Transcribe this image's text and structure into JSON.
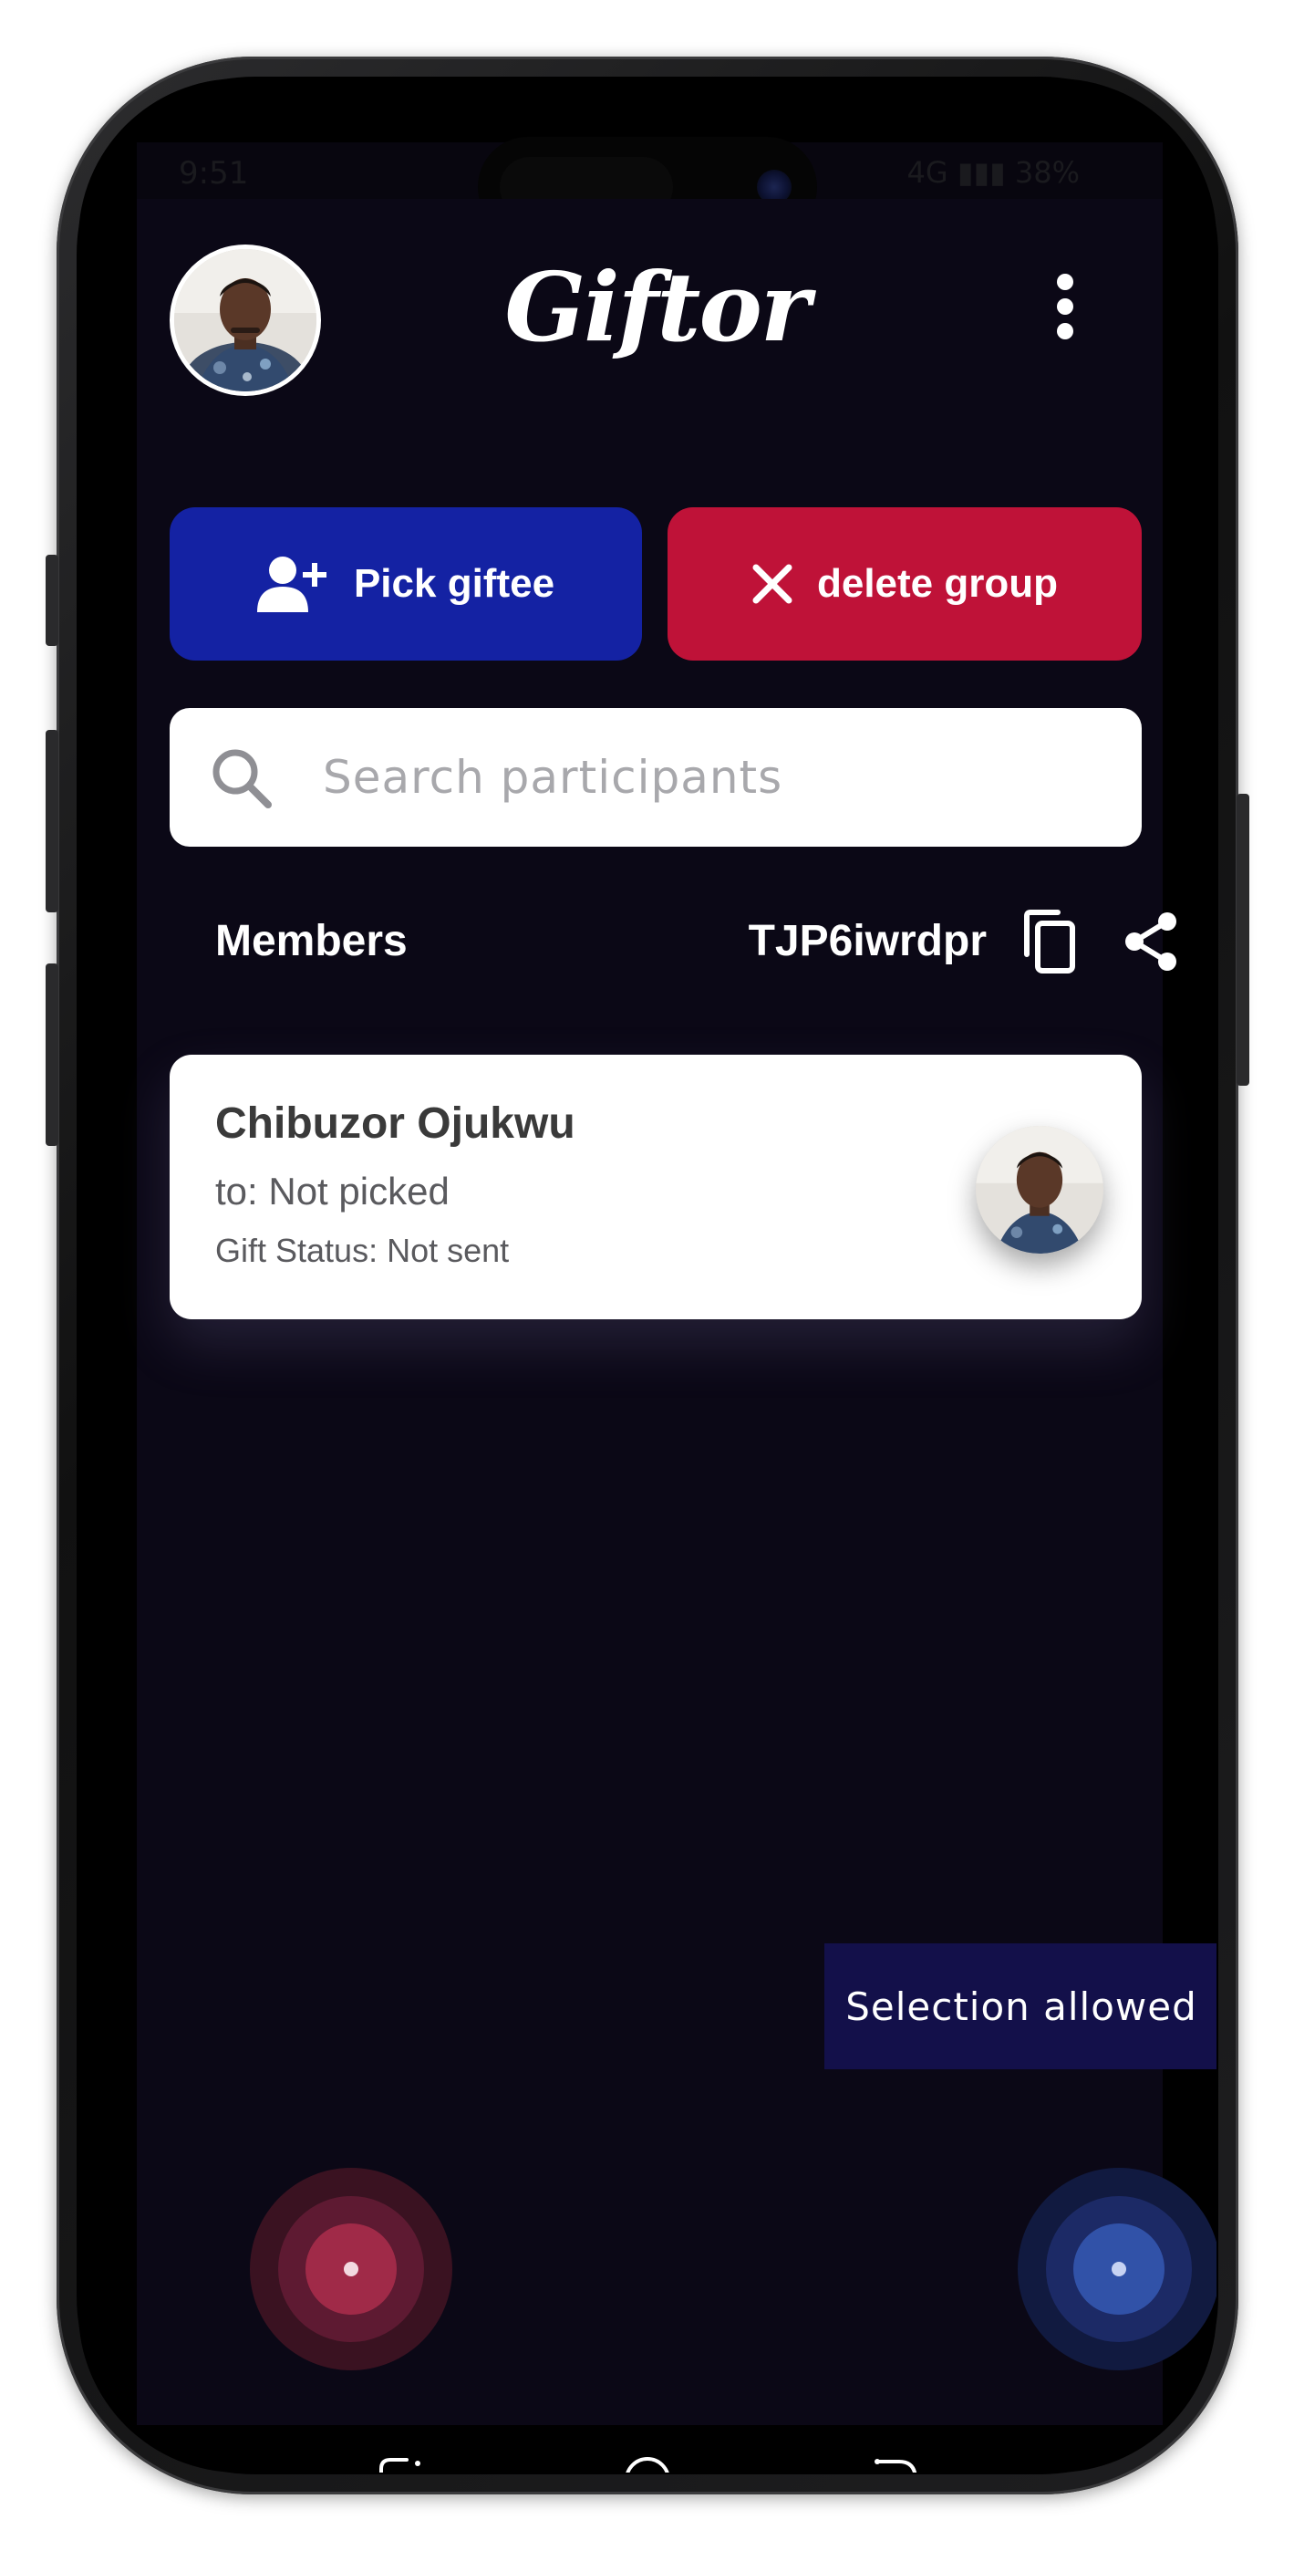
{
  "app": {
    "title": "Giftor",
    "status_time": "9:51",
    "status_right": "4G ▮▮▮ 38%"
  },
  "actions": {
    "pick_label": "Pick giftee",
    "delete_label": "delete group"
  },
  "search": {
    "placeholder": "Search participants",
    "value": ""
  },
  "members": {
    "label": "Members",
    "group_code": "TJP6iwrdpr",
    "list": [
      {
        "name": "Chibuzor Ojukwu",
        "to": "to: Not picked",
        "gift_status": "Gift Status: Not sent"
      }
    ]
  },
  "selection": {
    "label": "Selection allowed"
  },
  "icons": {
    "pick": "add-person-icon",
    "delete": "close-icon",
    "search": "search-icon",
    "copy": "copy-icon",
    "share": "share-icon",
    "menu": "more-vert-icon",
    "nav_recent": "recents-icon",
    "nav_home": "home-icon",
    "nav_back": "back-icon"
  },
  "colors": {
    "background": "#0b0816",
    "pick_button": "#1422a3",
    "delete_button": "#bf1238",
    "selection_pill": "#13104a"
  }
}
